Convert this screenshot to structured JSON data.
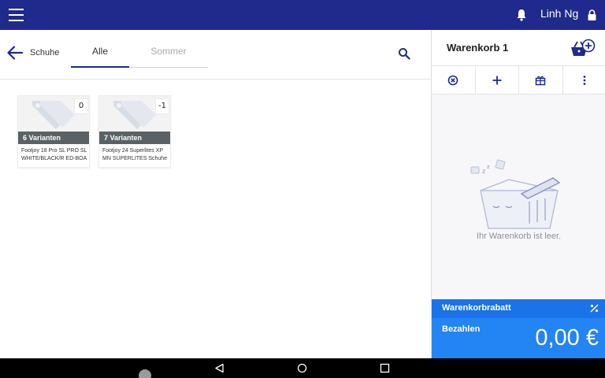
{
  "app_bar": {
    "user_name": "Linh Ng",
    "icons": [
      "menu-icon",
      "bell-icon",
      "lock-icon"
    ]
  },
  "catalog": {
    "back_label": "Schuhe",
    "tabs": [
      {
        "label": "Alle",
        "active": true
      },
      {
        "label": "Sommer",
        "active": false
      }
    ],
    "products": [
      {
        "stock": "0",
        "variants": "6 Varianten",
        "name": "Footjoy 18 Pro SL PRO SL WHITE/BLACK/R ED-BOA"
      },
      {
        "stock": "-1",
        "variants": "7 Varianten",
        "name": "Footjoy 24 Superlites XP MN SUPERLITES Schuhe"
      }
    ]
  },
  "cart": {
    "title": "Warenkorb 1",
    "empty_text": "Ihr Warenkorb ist leer.",
    "discount_label": "Warenkorbrabatt",
    "pay_label": "Bezahlen",
    "total": "0,00 €",
    "action_icons": [
      "cancel-circle-icon",
      "plus-icon",
      "gift-icon",
      "more-vert-icon"
    ]
  },
  "colors": {
    "appbar": "#1f2a8c",
    "discount": "#1a73e8",
    "pay": "#2384f3",
    "variants_bar": "#5a6266"
  }
}
